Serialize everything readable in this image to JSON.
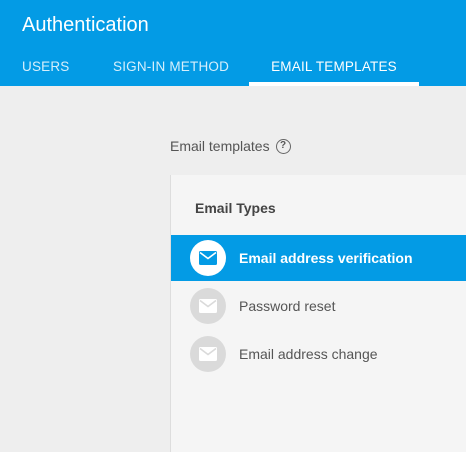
{
  "header": {
    "title": "Authentication",
    "tabs": [
      {
        "label": "USERS"
      },
      {
        "label": "SIGN-IN METHOD"
      },
      {
        "label": "EMAIL TEMPLATES"
      }
    ],
    "active_tab": "EMAIL TEMPLATES"
  },
  "main": {
    "section_label": "Email templates",
    "help_icon": "help-circle-icon",
    "panel": {
      "title": "Email Types",
      "items": [
        {
          "label": "Email address verification",
          "icon": "mail-icon",
          "selected": true
        },
        {
          "label": "Password reset",
          "icon": "mail-icon",
          "selected": false
        },
        {
          "label": "Email address change",
          "icon": "mail-icon",
          "selected": false
        }
      ]
    }
  },
  "colors": {
    "primary": "#039be5",
    "background": "#eeeeee",
    "panel_background": "#f5f5f5",
    "icon_circle_inactive": "#dadada"
  }
}
